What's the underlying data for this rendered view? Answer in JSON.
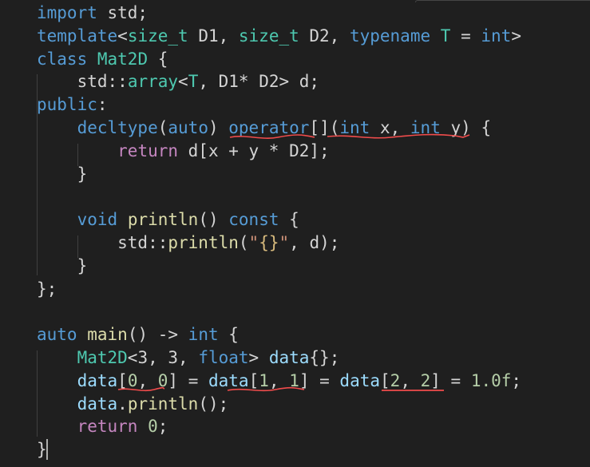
{
  "editor": {
    "language": "C++",
    "theme_colors": {
      "background": "#1f1f1f",
      "keyword": "#569cd6",
      "control": "#c586c0",
      "type": "#4ec9b0",
      "function": "#dcdcaa",
      "variable": "#9cdcfe",
      "number": "#b5cea8",
      "string": "#ce9178",
      "escape": "#d7ba7d",
      "plain": "#d4d4d4",
      "error_squiggle": "#f14c4c"
    },
    "lines": [
      [
        {
          "t": "import",
          "c": "kw"
        },
        {
          "t": " std;",
          "c": "pl"
        }
      ],
      [
        {
          "t": "template",
          "c": "kw"
        },
        {
          "t": "<",
          "c": "pl"
        },
        {
          "t": "size_t",
          "c": "ty"
        },
        {
          "t": " D1, ",
          "c": "pl"
        },
        {
          "t": "size_t",
          "c": "ty"
        },
        {
          "t": " D2, ",
          "c": "pl"
        },
        {
          "t": "typename",
          "c": "kw"
        },
        {
          "t": " ",
          "c": "pl"
        },
        {
          "t": "T",
          "c": "ty"
        },
        {
          "t": " = ",
          "c": "pl"
        },
        {
          "t": "int",
          "c": "kw"
        },
        {
          "t": ">",
          "c": "pl"
        }
      ],
      [
        {
          "t": "class",
          "c": "kw"
        },
        {
          "t": " ",
          "c": "pl"
        },
        {
          "t": "Mat2D",
          "c": "ty"
        },
        {
          "t": " {",
          "c": "pl"
        }
      ],
      [
        {
          "t": "    std",
          "c": "pl"
        },
        {
          "t": "::",
          "c": "pl"
        },
        {
          "t": "array",
          "c": "ty"
        },
        {
          "t": "<",
          "c": "pl"
        },
        {
          "t": "T",
          "c": "ty"
        },
        {
          "t": ", D1* D2> d;",
          "c": "pl"
        }
      ],
      [
        {
          "t": "public",
          "c": "kw"
        },
        {
          "t": ":",
          "c": "pl"
        }
      ],
      [
        {
          "t": "    ",
          "c": "pl"
        },
        {
          "t": "decltype",
          "c": "kw"
        },
        {
          "t": "(",
          "c": "pl"
        },
        {
          "t": "auto",
          "c": "kw"
        },
        {
          "t": ") ",
          "c": "pl"
        },
        {
          "t": "operator",
          "c": "kw"
        },
        {
          "t": "[](",
          "c": "pl"
        },
        {
          "t": "int",
          "c": "kw"
        },
        {
          "t": " ",
          "c": "pl"
        },
        {
          "t": "x",
          "c": "pl"
        },
        {
          "t": ", ",
          "c": "pl"
        },
        {
          "t": "int",
          "c": "kw"
        },
        {
          "t": " ",
          "c": "pl"
        },
        {
          "t": "y",
          "c": "pl"
        },
        {
          "t": ") {",
          "c": "pl"
        }
      ],
      [
        {
          "t": "        ",
          "c": "pl"
        },
        {
          "t": "return",
          "c": "ctl"
        },
        {
          "t": " d[x + y * D2];",
          "c": "pl"
        }
      ],
      [
        {
          "t": "    }",
          "c": "pl"
        }
      ],
      [
        {
          "t": "",
          "c": "pl"
        }
      ],
      [
        {
          "t": "    ",
          "c": "pl"
        },
        {
          "t": "void",
          "c": "kw"
        },
        {
          "t": " ",
          "c": "pl"
        },
        {
          "t": "println",
          "c": "fn"
        },
        {
          "t": "() ",
          "c": "pl"
        },
        {
          "t": "const",
          "c": "kw"
        },
        {
          "t": " {",
          "c": "pl"
        }
      ],
      [
        {
          "t": "        std::",
          "c": "pl"
        },
        {
          "t": "println",
          "c": "fn"
        },
        {
          "t": "(",
          "c": "pl"
        },
        {
          "t": "\"",
          "c": "str"
        },
        {
          "t": "{}",
          "c": "esc"
        },
        {
          "t": "\"",
          "c": "str"
        },
        {
          "t": ", d);",
          "c": "pl"
        }
      ],
      [
        {
          "t": "    }",
          "c": "pl"
        }
      ],
      [
        {
          "t": "};",
          "c": "pl"
        }
      ],
      [
        {
          "t": "",
          "c": "pl"
        }
      ],
      [
        {
          "t": "auto",
          "c": "kw"
        },
        {
          "t": " ",
          "c": "pl"
        },
        {
          "t": "main",
          "c": "fn"
        },
        {
          "t": "() -> ",
          "c": "pl"
        },
        {
          "t": "int",
          "c": "kw"
        },
        {
          "t": " {",
          "c": "pl"
        }
      ],
      [
        {
          "t": "    ",
          "c": "pl"
        },
        {
          "t": "Mat2D",
          "c": "ty"
        },
        {
          "t": "<3, 3, ",
          "c": "pl"
        },
        {
          "t": "float",
          "c": "kw"
        },
        {
          "t": "> ",
          "c": "pl"
        },
        {
          "t": "data",
          "c": "var"
        },
        {
          "t": "{};",
          "c": "pl"
        }
      ],
      [
        {
          "t": "    ",
          "c": "pl"
        },
        {
          "t": "data",
          "c": "var"
        },
        {
          "t": "[",
          "c": "pl"
        },
        {
          "t": "0",
          "c": "num"
        },
        {
          "t": ", ",
          "c": "pl"
        },
        {
          "t": "0",
          "c": "num"
        },
        {
          "t": "] = ",
          "c": "pl"
        },
        {
          "t": "data",
          "c": "var"
        },
        {
          "t": "[",
          "c": "pl"
        },
        {
          "t": "1",
          "c": "num"
        },
        {
          "t": ", ",
          "c": "pl"
        },
        {
          "t": "1",
          "c": "num"
        },
        {
          "t": "] = ",
          "c": "pl"
        },
        {
          "t": "data",
          "c": "var"
        },
        {
          "t": "[",
          "c": "pl"
        },
        {
          "t": "2",
          "c": "num"
        },
        {
          "t": ", ",
          "c": "pl"
        },
        {
          "t": "2",
          "c": "num"
        },
        {
          "t": "] = ",
          "c": "pl"
        },
        {
          "t": "1.0f",
          "c": "num"
        },
        {
          "t": ";",
          "c": "pl"
        }
      ],
      [
        {
          "t": "    ",
          "c": "pl"
        },
        {
          "t": "data",
          "c": "var"
        },
        {
          "t": ".",
          "c": "pl"
        },
        {
          "t": "println",
          "c": "fn"
        },
        {
          "t": "();",
          "c": "pl"
        }
      ],
      [
        {
          "t": "    ",
          "c": "pl"
        },
        {
          "t": "return",
          "c": "ctl"
        },
        {
          "t": " ",
          "c": "pl"
        },
        {
          "t": "0",
          "c": "num"
        },
        {
          "t": ";",
          "c": "pl"
        }
      ],
      [
        {
          "t": "}",
          "c": "pl"
        }
      ]
    ]
  }
}
